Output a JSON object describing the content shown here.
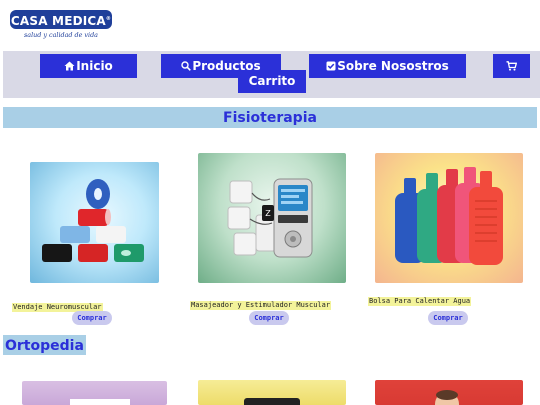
{
  "brand": {
    "name": "CASA MEDICA",
    "registered": "®",
    "tagline": "salud y calidad de vida"
  },
  "nav": {
    "inicio": "Inicio",
    "productos": "Productos",
    "sobre": "Sobre Nosostros",
    "carrito": "Carrito"
  },
  "sections": [
    {
      "title": "Fisioterapia",
      "products": [
        {
          "name": "Vendaje Neuromuscular",
          "button": "Comprar"
        },
        {
          "name": "Masajeador y Estimulador Muscular",
          "button": "Comprar"
        },
        {
          "name": "Bolsa Para Calentar Agua",
          "button": "Comprar"
        }
      ]
    },
    {
      "title": "Ortopedia"
    }
  ],
  "colors": {
    "accent": "#2b30d8",
    "nav_bg": "#d9d9e6",
    "section_bg": "#a9cfe6",
    "label_bg": "#f3f39a",
    "button_bg": "#c9c9ee"
  },
  "icons": {
    "inicio": "home-icon",
    "productos": "search-icon",
    "sobre": "check-square-icon",
    "carrito": "cart-icon"
  }
}
